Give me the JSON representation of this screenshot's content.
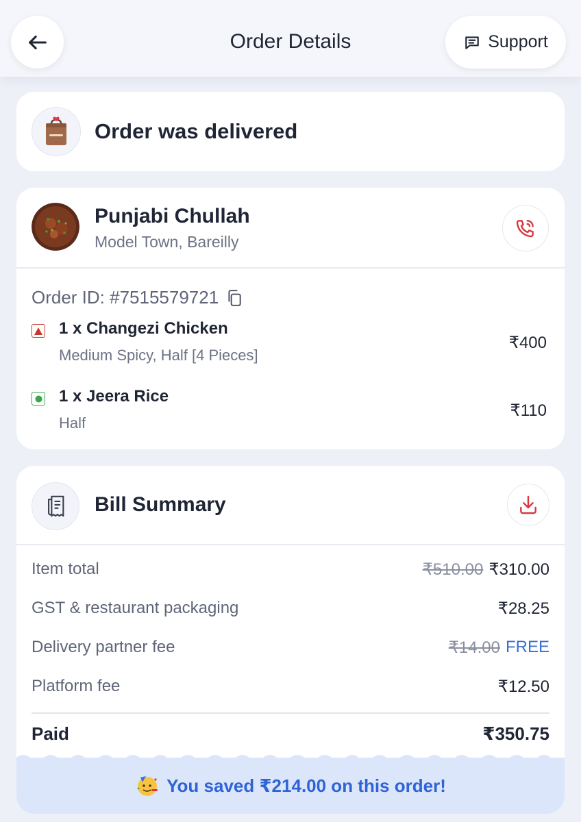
{
  "header": {
    "title": "Order Details",
    "support_label": "Support"
  },
  "status": {
    "text": "Order was delivered"
  },
  "restaurant": {
    "name": "Punjabi Chullah",
    "location": "Model Town, Bareilly"
  },
  "order": {
    "id_label": "Order ID: #7515579721",
    "items": [
      {
        "name": "1 x Changezi Chicken",
        "desc": "Medium Spicy, Half [4 Pieces]",
        "price": "₹400",
        "type": "non-veg"
      },
      {
        "name": "1 x Jeera Rice",
        "desc": "Half",
        "price": "₹110",
        "type": "veg"
      }
    ]
  },
  "bill": {
    "title": "Bill Summary",
    "rows": [
      {
        "label": "Item total",
        "old": "₹510.00",
        "value": "₹310.00"
      },
      {
        "label": "GST & restaurant packaging",
        "value": "₹28.25"
      },
      {
        "label": "Delivery partner fee",
        "old": "₹14.00",
        "value": "FREE"
      },
      {
        "label": "Platform fee",
        "value": "₹12.50"
      }
    ],
    "paid_label": "Paid",
    "paid_value": "₹350.75",
    "savings_text": "You saved ₹214.00 on this order!"
  },
  "colors": {
    "accent_red": "#d9363e",
    "savings_blue": "#2f63d6",
    "veg_green": "#3aa54a",
    "nonveg_red": "#c8372d"
  },
  "icons": {
    "back": "arrow-left-icon",
    "support": "chat-icon",
    "status": "delivery-bag-icon",
    "call": "phone-icon",
    "copy": "copy-icon",
    "bill": "receipt-icon",
    "download": "download-icon",
    "savings": "party-face-icon"
  }
}
